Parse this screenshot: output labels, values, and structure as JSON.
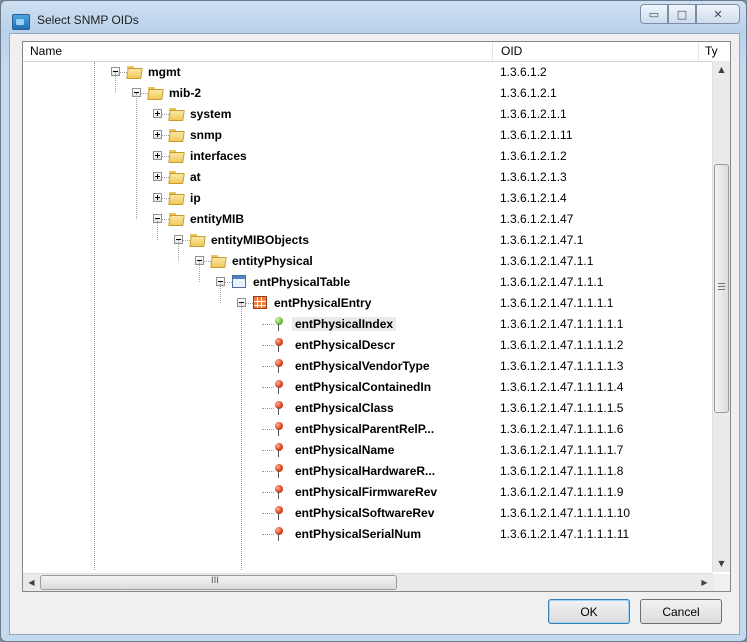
{
  "window": {
    "title": "Select SNMP OIDs",
    "controls": {
      "minimize": "▭",
      "maximize": "□",
      "close": "✕"
    }
  },
  "columns": {
    "name": "Name",
    "oid": "OID",
    "type": "Ty"
  },
  "tree_rows": [
    {
      "label": "mgmt",
      "oid": "1.3.6.1.2",
      "icon": "folder-icon",
      "expander": "minus"
    },
    {
      "label": "mib-2",
      "oid": "1.3.6.1.2.1",
      "icon": "folder-icon",
      "expander": "minus"
    },
    {
      "label": "system",
      "oid": "1.3.6.1.2.1.1",
      "icon": "folder-icon",
      "expander": "plus"
    },
    {
      "label": "snmp",
      "oid": "1.3.6.1.2.1.11",
      "icon": "folder-icon",
      "expander": "plus"
    },
    {
      "label": "interfaces",
      "oid": "1.3.6.1.2.1.2",
      "icon": "folder-icon",
      "expander": "plus"
    },
    {
      "label": "at",
      "oid": "1.3.6.1.2.1.3",
      "icon": "folder-icon",
      "expander": "plus"
    },
    {
      "label": "ip",
      "oid": "1.3.6.1.2.1.4",
      "icon": "folder-icon",
      "expander": "plus"
    },
    {
      "label": "entityMIB",
      "oid": "1.3.6.1.2.1.47",
      "icon": "folder-icon",
      "expander": "minus"
    },
    {
      "label": "entityMIBObjects",
      "oid": "1.3.6.1.2.1.47.1",
      "icon": "folder-icon",
      "expander": "minus"
    },
    {
      "label": "entityPhysical",
      "oid": "1.3.6.1.2.1.47.1.1",
      "icon": "folder-icon",
      "expander": "minus"
    },
    {
      "label": "entPhysicalTable",
      "oid": "1.3.6.1.2.1.47.1.1.1",
      "icon": "table-icon",
      "expander": "minus"
    },
    {
      "label": "entPhysicalEntry",
      "oid": "1.3.6.1.2.1.47.1.1.1.1",
      "icon": "entry-icon",
      "expander": "minus"
    },
    {
      "label": "entPhysicalIndex",
      "oid": "1.3.6.1.2.1.47.1.1.1.1.1",
      "icon": "key-pin-icon",
      "expander": "none",
      "selected": true
    },
    {
      "label": "entPhysicalDescr",
      "oid": "1.3.6.1.2.1.47.1.1.1.1.2",
      "icon": "pin-icon",
      "expander": "none"
    },
    {
      "label": "entPhysicalVendorType",
      "oid": "1.3.6.1.2.1.47.1.1.1.1.3",
      "icon": "pin-icon",
      "expander": "none"
    },
    {
      "label": "entPhysicalContainedIn",
      "oid": "1.3.6.1.2.1.47.1.1.1.1.4",
      "icon": "pin-icon",
      "expander": "none"
    },
    {
      "label": "entPhysicalClass",
      "oid": "1.3.6.1.2.1.47.1.1.1.1.5",
      "icon": "pin-icon",
      "expander": "none"
    },
    {
      "label": "entPhysicalParentRelP...",
      "oid": "1.3.6.1.2.1.47.1.1.1.1.6",
      "icon": "pin-icon",
      "expander": "none"
    },
    {
      "label": "entPhysicalName",
      "oid": "1.3.6.1.2.1.47.1.1.1.1.7",
      "icon": "pin-icon",
      "expander": "none"
    },
    {
      "label": "entPhysicalHardwareR...",
      "oid": "1.3.6.1.2.1.47.1.1.1.1.8",
      "icon": "pin-icon",
      "expander": "none"
    },
    {
      "label": "entPhysicalFirmwareRev",
      "oid": "1.3.6.1.2.1.47.1.1.1.1.9",
      "icon": "pin-icon",
      "expander": "none"
    },
    {
      "label": "entPhysicalSoftwareRev",
      "oid": "1.3.6.1.2.1.47.1.1.1.1.10",
      "icon": "pin-icon",
      "expander": "none"
    },
    {
      "label": "entPhysicalSerialNum",
      "oid": "1.3.6.1.2.1.47.1.1.1.1.11",
      "icon": "pin-icon",
      "expander": "none"
    }
  ],
  "scrollbars": {
    "up": "▲",
    "down": "▼",
    "left": "◀",
    "right": "▶",
    "hgrip": "III"
  },
  "buttons": {
    "ok": "OK",
    "cancel": "Cancel"
  }
}
